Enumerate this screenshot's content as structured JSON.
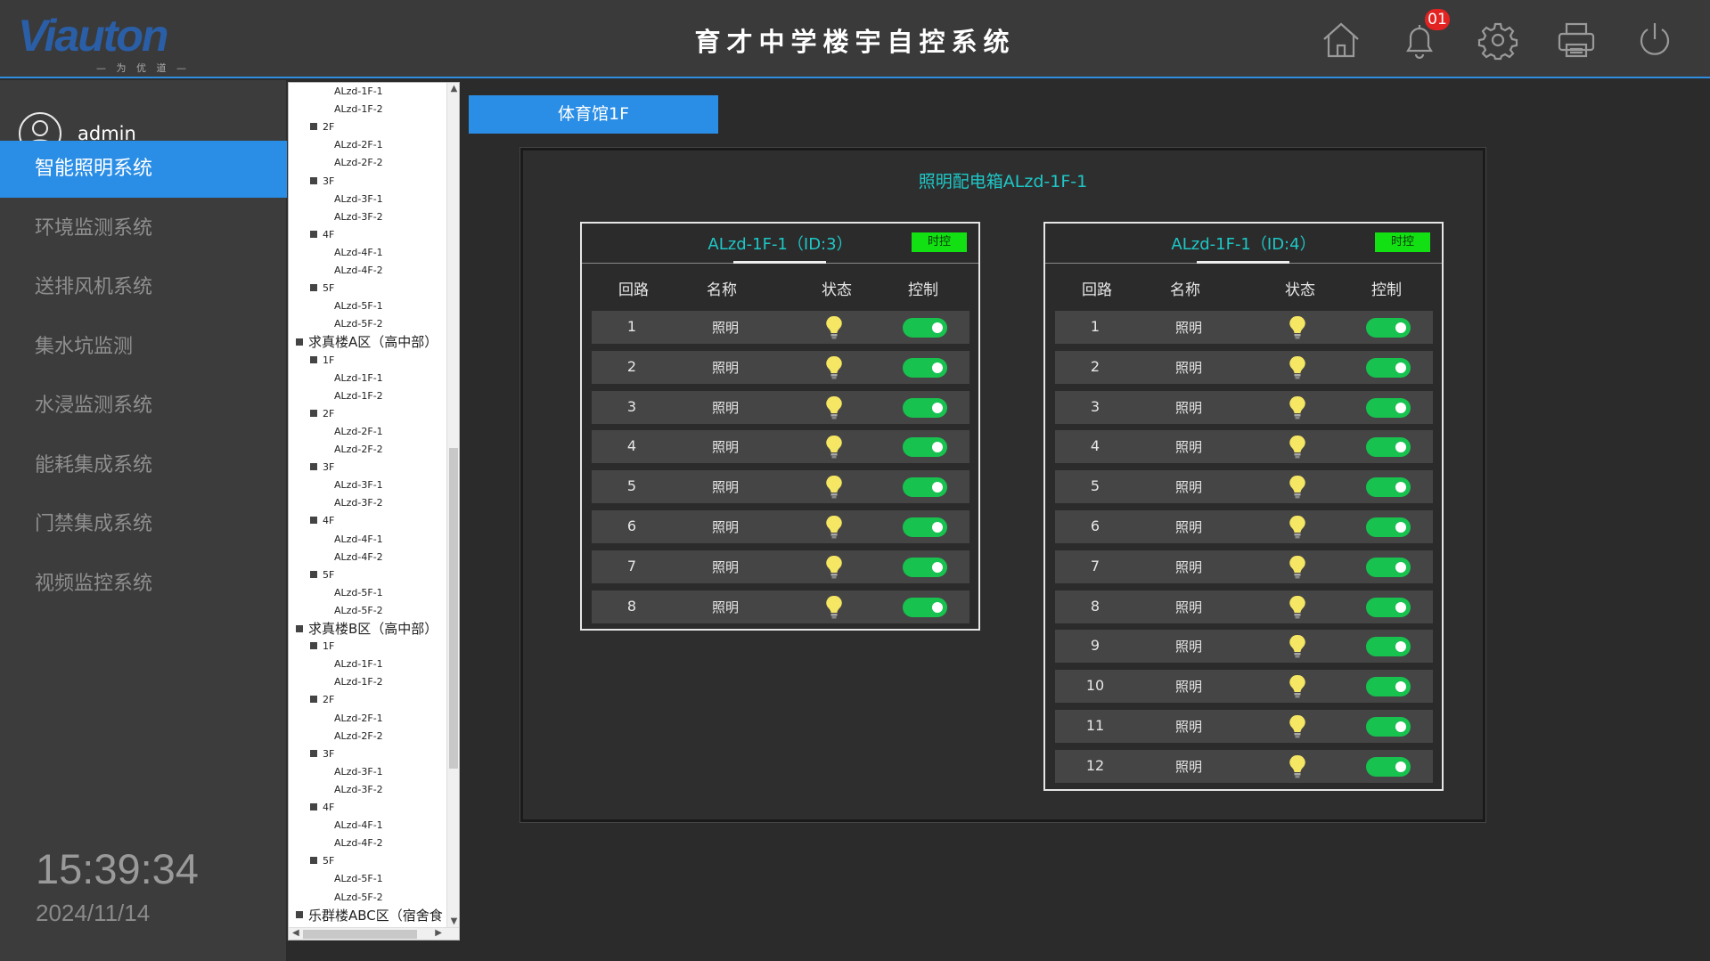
{
  "header": {
    "brand_main": "Viauton",
    "brand_sub": "— 为 优 道 —",
    "title": "育才中学楼宇自控系统",
    "notification_count": "01",
    "icons": [
      "home-icon",
      "bell-icon",
      "gear-icon",
      "printer-icon",
      "power-icon"
    ]
  },
  "sidebar": {
    "user": "admin",
    "items": [
      {
        "label": "智能照明系统",
        "active": true
      },
      {
        "label": "环境监测系统",
        "active": false
      },
      {
        "label": "送排风机系统",
        "active": false
      },
      {
        "label": "集水坑监测",
        "active": false
      },
      {
        "label": "水浸监测系统",
        "active": false
      },
      {
        "label": "能耗集成系统",
        "active": false
      },
      {
        "label": "门禁集成系统",
        "active": false
      },
      {
        "label": "视频监控系统",
        "active": false
      }
    ],
    "time": "15:39:34",
    "date": "2024/11/14"
  },
  "tree": [
    {
      "label": "ALzd-1F-1",
      "level": 3
    },
    {
      "label": "ALzd-1F-2",
      "level": 3
    },
    {
      "label": "2F",
      "level": 2
    },
    {
      "label": "ALzd-2F-1",
      "level": 3
    },
    {
      "label": "ALzd-2F-2",
      "level": 3
    },
    {
      "label": "3F",
      "level": 2
    },
    {
      "label": "ALzd-3F-1",
      "level": 3
    },
    {
      "label": "ALzd-3F-2",
      "level": 3
    },
    {
      "label": "4F",
      "level": 2
    },
    {
      "label": "ALzd-4F-1",
      "level": 3
    },
    {
      "label": "ALzd-4F-2",
      "level": 3
    },
    {
      "label": "5F",
      "level": 2
    },
    {
      "label": "ALzd-5F-1",
      "level": 3
    },
    {
      "label": "ALzd-5F-2",
      "level": 3
    },
    {
      "label": "求真楼A区（高中部）",
      "level": 1
    },
    {
      "label": "1F",
      "level": 2
    },
    {
      "label": "ALzd-1F-1",
      "level": 3
    },
    {
      "label": "ALzd-1F-2",
      "level": 3
    },
    {
      "label": "2F",
      "level": 2
    },
    {
      "label": "ALzd-2F-1",
      "level": 3
    },
    {
      "label": "ALzd-2F-2",
      "level": 3
    },
    {
      "label": "3F",
      "level": 2
    },
    {
      "label": "ALzd-3F-1",
      "level": 3
    },
    {
      "label": "ALzd-3F-2",
      "level": 3
    },
    {
      "label": "4F",
      "level": 2
    },
    {
      "label": "ALzd-4F-1",
      "level": 3
    },
    {
      "label": "ALzd-4F-2",
      "level": 3
    },
    {
      "label": "5F",
      "level": 2
    },
    {
      "label": "ALzd-5F-1",
      "level": 3
    },
    {
      "label": "ALzd-5F-2",
      "level": 3
    },
    {
      "label": "求真楼B区（高中部）",
      "level": 1
    },
    {
      "label": "1F",
      "level": 2
    },
    {
      "label": "ALzd-1F-1",
      "level": 3
    },
    {
      "label": "ALzd-1F-2",
      "level": 3
    },
    {
      "label": "2F",
      "level": 2
    },
    {
      "label": "ALzd-2F-1",
      "level": 3
    },
    {
      "label": "ALzd-2F-2",
      "level": 3
    },
    {
      "label": "3F",
      "level": 2
    },
    {
      "label": "ALzd-3F-1",
      "level": 3
    },
    {
      "label": "ALzd-3F-2",
      "level": 3
    },
    {
      "label": "4F",
      "level": 2
    },
    {
      "label": "ALzd-4F-1",
      "level": 3
    },
    {
      "label": "ALzd-4F-2",
      "level": 3
    },
    {
      "label": "5F",
      "level": 2
    },
    {
      "label": "ALzd-5F-1",
      "level": 3
    },
    {
      "label": "ALzd-5F-2",
      "level": 3
    },
    {
      "label": "乐群楼ABC区（宿舍食",
      "level": 1
    }
  ],
  "floor_tab": "体育馆1F",
  "panel": {
    "title": "照明配电箱ALzd-1F-1",
    "columns": [
      "回路",
      "名称",
      "状态",
      "控制"
    ],
    "timer_label": "时控",
    "boxes": [
      {
        "title": "ALzd-1F-1（ID:3）",
        "rows": [
          {
            "num": "1",
            "name": "照明",
            "on": true
          },
          {
            "num": "2",
            "name": "照明",
            "on": true
          },
          {
            "num": "3",
            "name": "照明",
            "on": true
          },
          {
            "num": "4",
            "name": "照明",
            "on": true
          },
          {
            "num": "5",
            "name": "照明",
            "on": true
          },
          {
            "num": "6",
            "name": "照明",
            "on": true
          },
          {
            "num": "7",
            "name": "照明",
            "on": true
          },
          {
            "num": "8",
            "name": "照明",
            "on": true
          }
        ]
      },
      {
        "title": "ALzd-1F-1（ID:4）",
        "rows": [
          {
            "num": "1",
            "name": "照明",
            "on": true
          },
          {
            "num": "2",
            "name": "照明",
            "on": true
          },
          {
            "num": "3",
            "name": "照明",
            "on": true
          },
          {
            "num": "4",
            "name": "照明",
            "on": true
          },
          {
            "num": "5",
            "name": "照明",
            "on": true
          },
          {
            "num": "6",
            "name": "照明",
            "on": true
          },
          {
            "num": "7",
            "name": "照明",
            "on": true
          },
          {
            "num": "8",
            "name": "照明",
            "on": true
          },
          {
            "num": "9",
            "name": "照明",
            "on": true
          },
          {
            "num": "10",
            "name": "照明",
            "on": true
          },
          {
            "num": "11",
            "name": "照明",
            "on": true
          },
          {
            "num": "12",
            "name": "照明",
            "on": true
          }
        ]
      }
    ]
  },
  "colors": {
    "accent": "#2b8ee6",
    "teal_text": "#1ec7c7",
    "switch_on": "#17c24f",
    "timer_green": "#12e012",
    "bulb": "#f5e663"
  }
}
